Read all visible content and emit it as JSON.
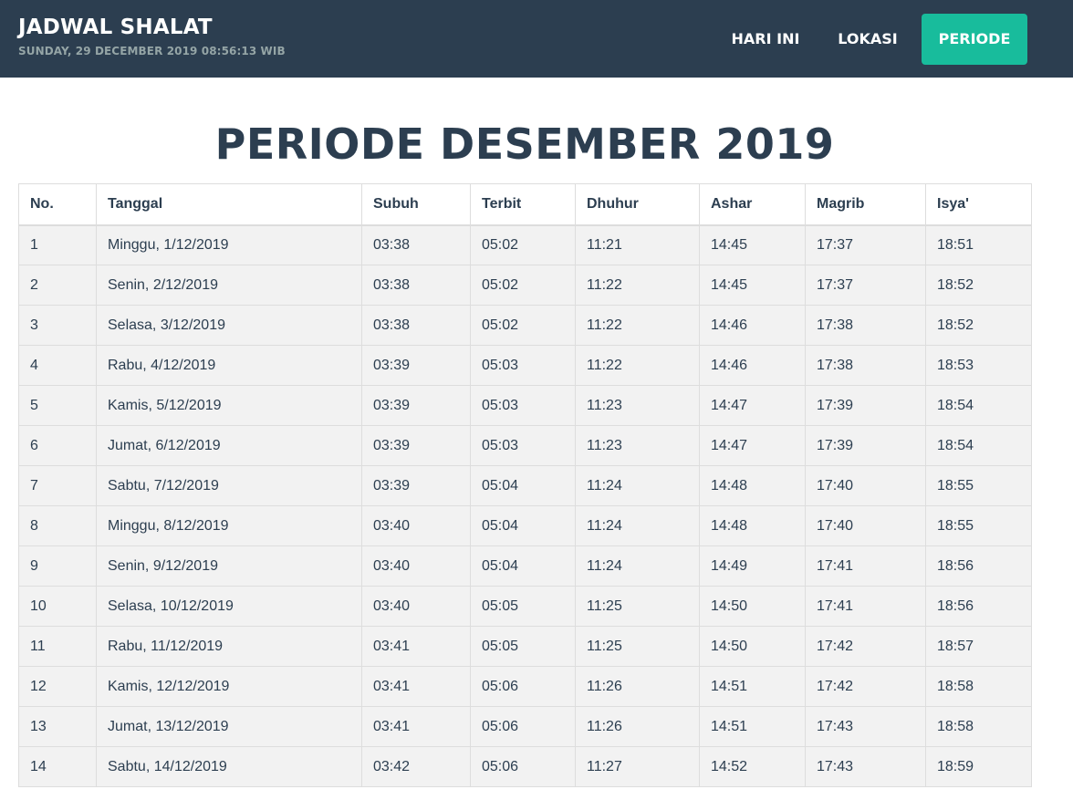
{
  "navbar": {
    "brand": "JADWAL SHALAT",
    "datetime": "SUNDAY, 29 DECEMBER 2019 08:56:13 WIB",
    "items": [
      "HARI INI",
      "LOKASI",
      "PERIODE"
    ],
    "active_item": "PERIODE",
    "colors": {
      "background": "#2c3e50",
      "active": "#18bc9c"
    }
  },
  "page_title": "PERIODE DESEMBER 2019",
  "table": {
    "headers": [
      "No.",
      "Tanggal",
      "Subuh",
      "Terbit",
      "Dhuhur",
      "Ashar",
      "Magrib",
      "Isya'"
    ],
    "rows": [
      [
        "1",
        "Minggu, 1/12/2019",
        "03:38",
        "05:02",
        "11:21",
        "14:45",
        "17:37",
        "18:51"
      ],
      [
        "2",
        "Senin, 2/12/2019",
        "03:38",
        "05:02",
        "11:22",
        "14:45",
        "17:37",
        "18:52"
      ],
      [
        "3",
        "Selasa, 3/12/2019",
        "03:38",
        "05:02",
        "11:22",
        "14:46",
        "17:38",
        "18:52"
      ],
      [
        "4",
        "Rabu, 4/12/2019",
        "03:39",
        "05:03",
        "11:22",
        "14:46",
        "17:38",
        "18:53"
      ],
      [
        "5",
        "Kamis, 5/12/2019",
        "03:39",
        "05:03",
        "11:23",
        "14:47",
        "17:39",
        "18:54"
      ],
      [
        "6",
        "Jumat, 6/12/2019",
        "03:39",
        "05:03",
        "11:23",
        "14:47",
        "17:39",
        "18:54"
      ],
      [
        "7",
        "Sabtu, 7/12/2019",
        "03:39",
        "05:04",
        "11:24",
        "14:48",
        "17:40",
        "18:55"
      ],
      [
        "8",
        "Minggu, 8/12/2019",
        "03:40",
        "05:04",
        "11:24",
        "14:48",
        "17:40",
        "18:55"
      ],
      [
        "9",
        "Senin, 9/12/2019",
        "03:40",
        "05:04",
        "11:24",
        "14:49",
        "17:41",
        "18:56"
      ],
      [
        "10",
        "Selasa, 10/12/2019",
        "03:40",
        "05:05",
        "11:25",
        "14:50",
        "17:41",
        "18:56"
      ],
      [
        "11",
        "Rabu, 11/12/2019",
        "03:41",
        "05:05",
        "11:25",
        "14:50",
        "17:42",
        "18:57"
      ],
      [
        "12",
        "Kamis, 12/12/2019",
        "03:41",
        "05:06",
        "11:26",
        "14:51",
        "17:42",
        "18:58"
      ],
      [
        "13",
        "Jumat, 13/12/2019",
        "03:41",
        "05:06",
        "11:26",
        "14:51",
        "17:43",
        "18:58"
      ],
      [
        "14",
        "Sabtu, 14/12/2019",
        "03:42",
        "05:06",
        "11:27",
        "14:52",
        "17:43",
        "18:59"
      ]
    ]
  }
}
